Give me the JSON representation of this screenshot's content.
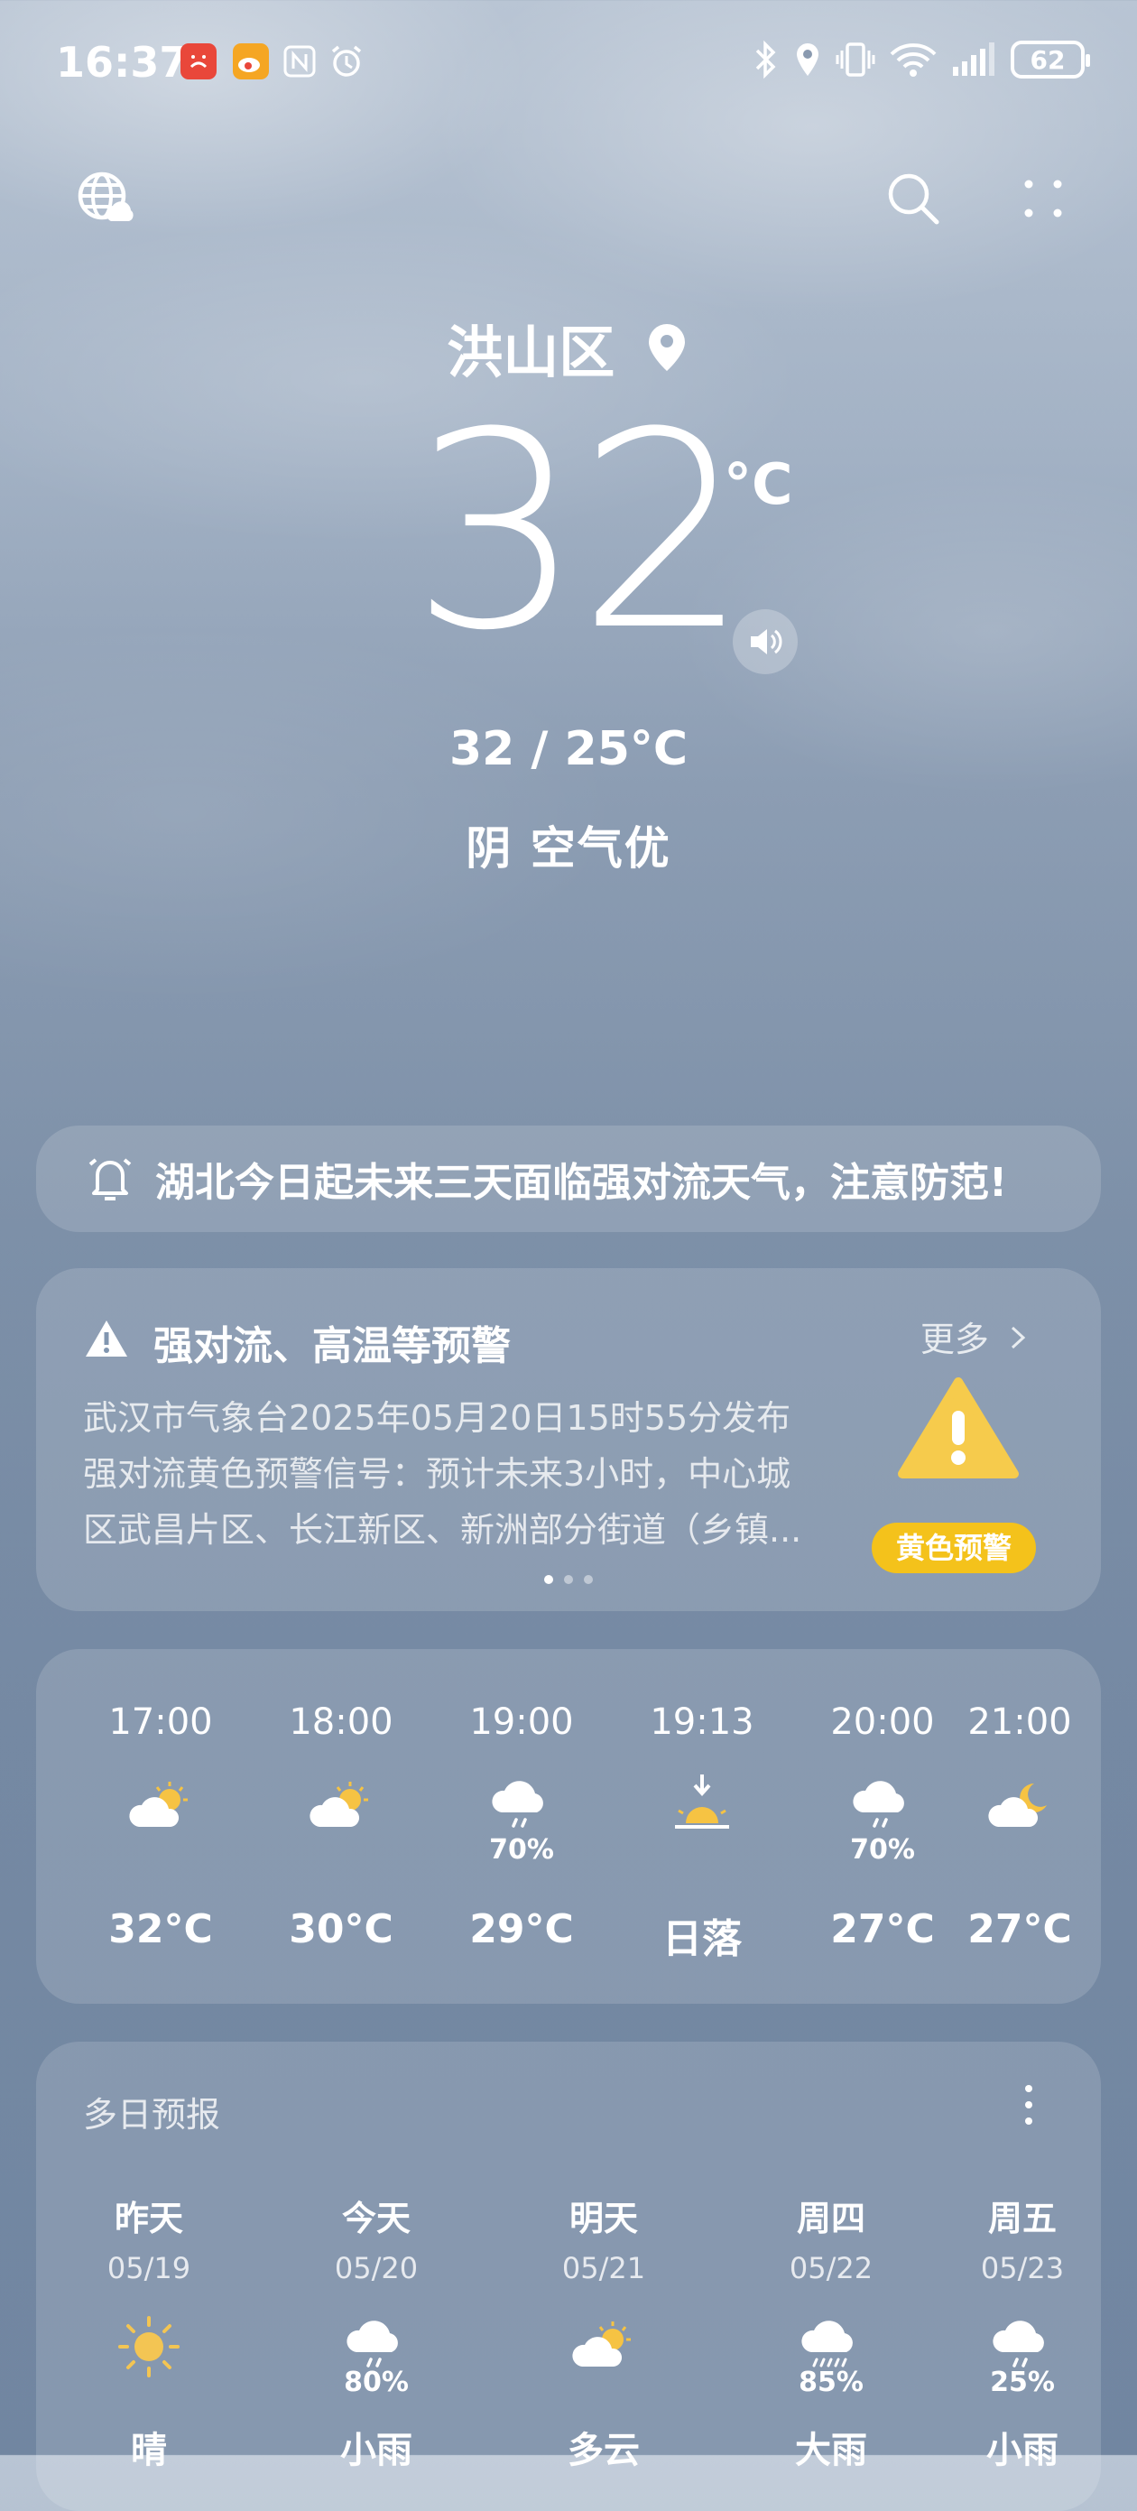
{
  "status_bar": {
    "time": "16:37",
    "battery": "62",
    "icons": [
      "app-red-icon",
      "weibo-icon",
      "nfc-icon",
      "alarm-icon",
      "bluetooth-icon",
      "location-icon",
      "vibrate-icon",
      "wifi-icon",
      "signal-icon",
      "battery-icon"
    ]
  },
  "header": {
    "globe_icon": "globe-cloud-icon",
    "search_icon": "search-icon",
    "menu_icon": "more-dots-icon"
  },
  "location": "洪山区",
  "current": {
    "temp": "32",
    "unit": "°C",
    "range": "32 / 25°C",
    "condition": "阴  空气优"
  },
  "notice": {
    "text": "湖北今日起未来三天面临强对流天气，注意防范!"
  },
  "warning": {
    "title": "强对流、高温等预警",
    "more": "更多",
    "lines": [
      "武汉市气象台2025年05月20日15时55分发布",
      "强对流黄色预警信号：预计未来3小时，中心城",
      "区武昌片区、长江新区、新洲部分街道（乡镇..."
    ],
    "badge": "黄色预警",
    "badge_color": "#f4c21b"
  },
  "hourly": [
    {
      "time": "17:00",
      "icon": "sun-cloud-icon",
      "precip": "",
      "value": "32°C"
    },
    {
      "time": "18:00",
      "icon": "sun-cloud-icon",
      "precip": "",
      "value": "30°C"
    },
    {
      "time": "19:00",
      "icon": "rain-cloud-icon",
      "precip": "70%",
      "value": "29°C"
    },
    {
      "time": "19:13",
      "icon": "sunset-icon",
      "precip": "",
      "value": "日落"
    },
    {
      "time": "20:00",
      "icon": "rain-cloud-icon",
      "precip": "70%",
      "value": "27°C"
    },
    {
      "time": "21:00",
      "icon": "moon-cloud-icon",
      "precip": "",
      "value": "27°C"
    }
  ],
  "daily": {
    "title": "多日预报",
    "days": [
      {
        "name": "昨天",
        "date": "05/19",
        "icon": "sun-icon",
        "precip": "",
        "weather": "晴"
      },
      {
        "name": "今天",
        "date": "05/20",
        "icon": "rain-cloud-icon",
        "precip": "80%",
        "weather": "小雨"
      },
      {
        "name": "明天",
        "date": "05/21",
        "icon": "sun-cloud-icon",
        "precip": "",
        "weather": "多云"
      },
      {
        "name": "周四",
        "date": "05/22",
        "icon": "heavy-rain-icon",
        "precip": "85%",
        "weather": "大雨"
      },
      {
        "name": "周五",
        "date": "05/23",
        "icon": "rain-cloud-icon",
        "precip": "25%",
        "weather": "小雨"
      }
    ]
  }
}
